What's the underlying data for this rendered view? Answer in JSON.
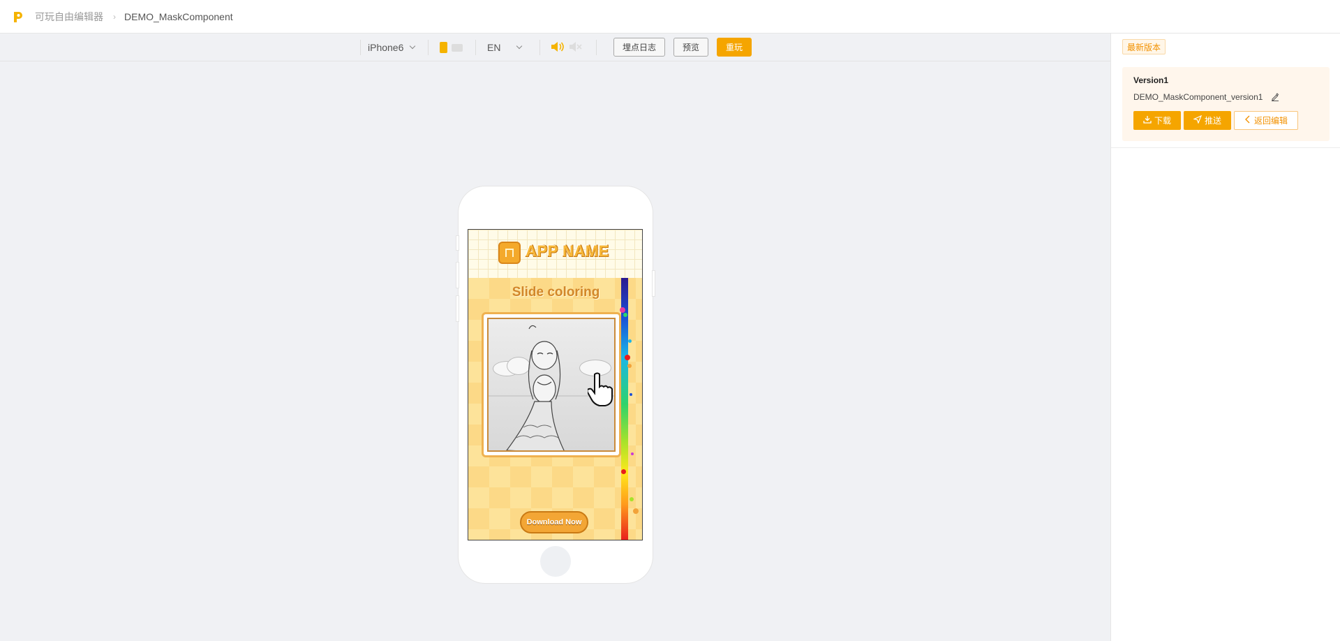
{
  "breadcrumb": {
    "root": "可玩自由编辑器",
    "current": "DEMO_MaskComponent"
  },
  "toolbar": {
    "device": "iPhone6",
    "language": "EN",
    "buttons": {
      "log": "埋点日志",
      "preview": "预览",
      "replay": "重玩"
    }
  },
  "preview": {
    "app_name": "APP NAME",
    "title": "Slide coloring",
    "cta": "Download Now"
  },
  "panel": {
    "latest_tag": "最新版本",
    "version_title": "Version1",
    "version_name": "DEMO_MaskComponent_version1",
    "download": "下载",
    "push": "推送",
    "back_edit": "返回编辑"
  },
  "colors": {
    "accent": "#f5a500",
    "accent_text": "#f29100",
    "panel_card": "#fff6ec"
  },
  "icons": [
    "logo-icon",
    "chevron-right-icon",
    "chevron-down-icon",
    "portrait-icon",
    "landscape-icon",
    "volume-on-icon",
    "volume-mute-icon",
    "edit-icon",
    "download-icon",
    "send-icon",
    "chevron-left-icon"
  ]
}
